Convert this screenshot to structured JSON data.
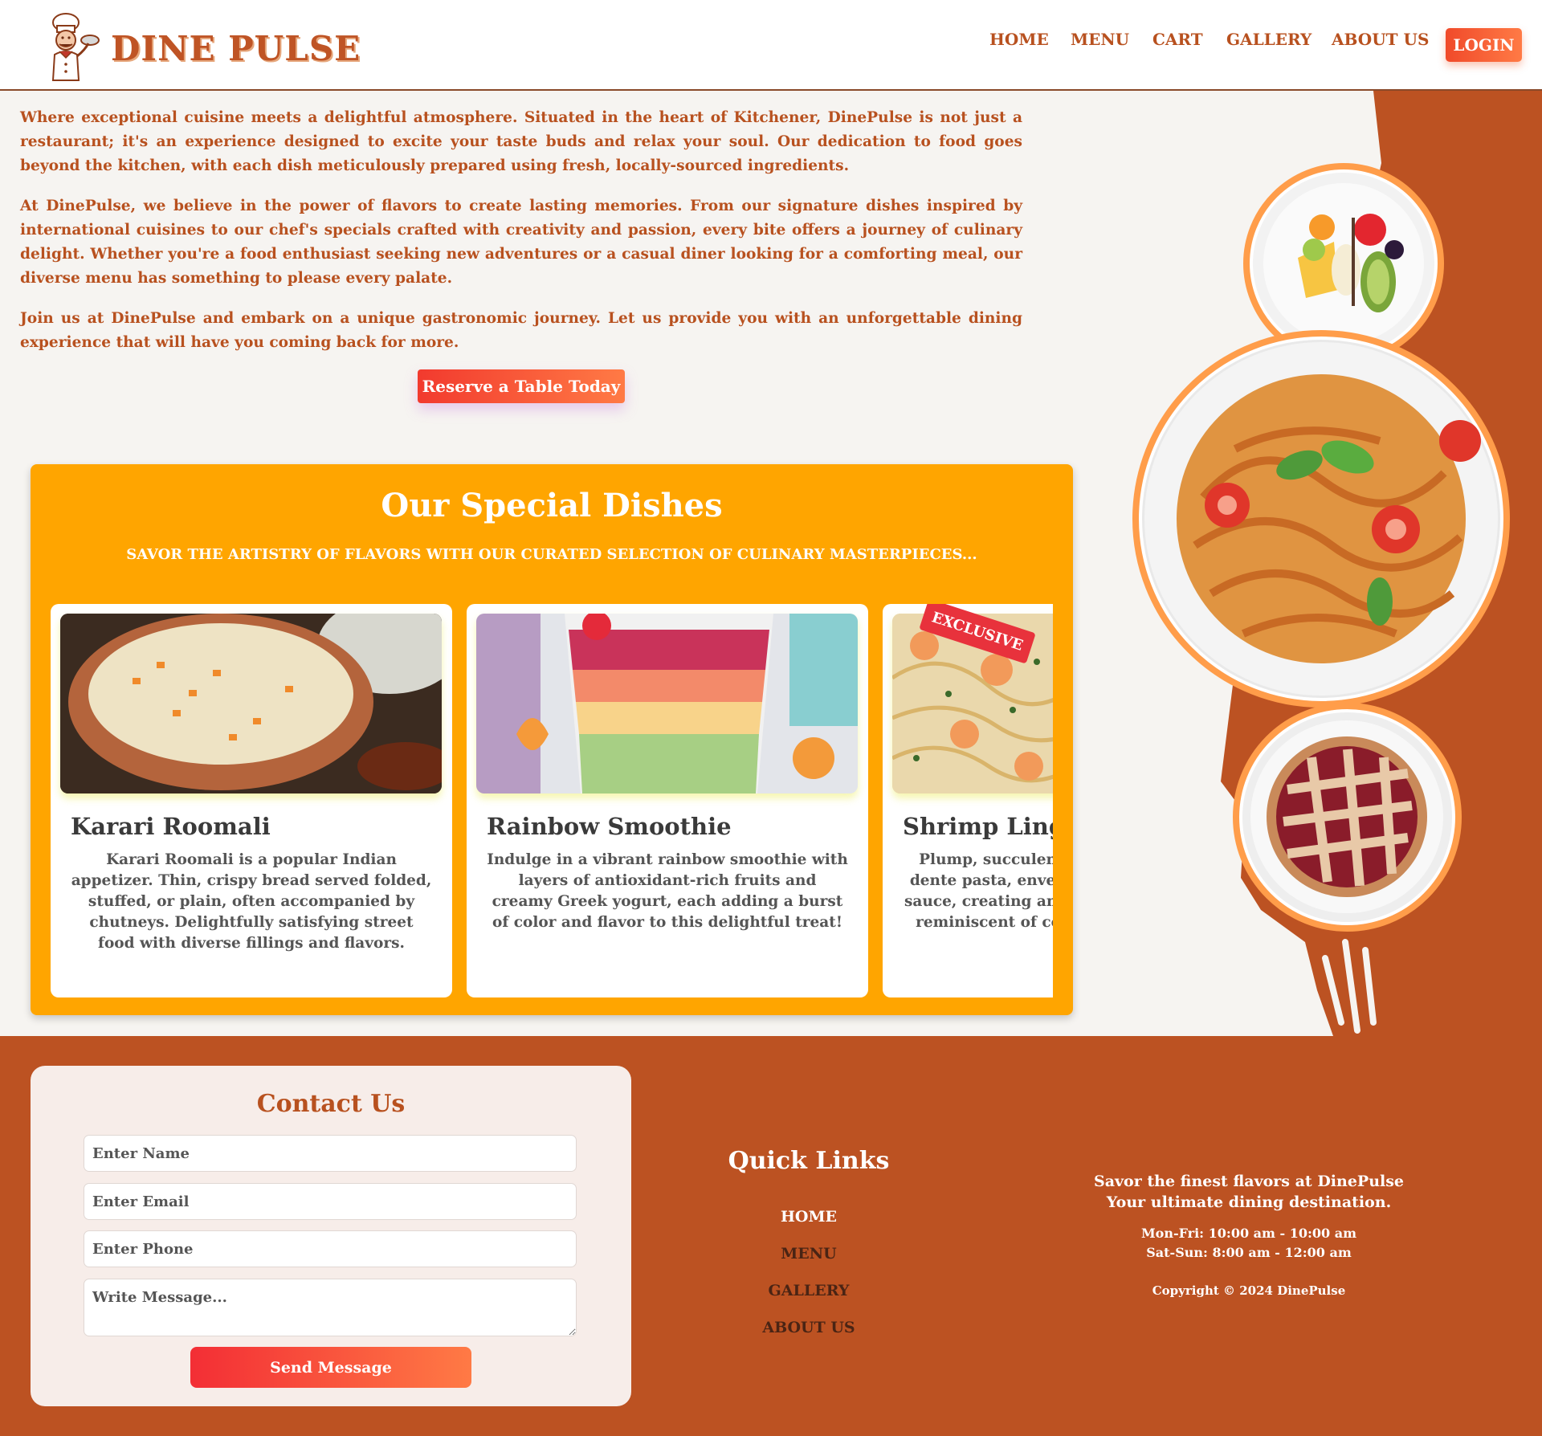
{
  "brand": {
    "name": "DINE PULSE"
  },
  "nav": {
    "items": [
      "HOME",
      "MENU",
      "CART",
      "GALLERY",
      "ABOUT US"
    ],
    "login_label": "LOGIN"
  },
  "intro": {
    "paragraphs": [
      "Where exceptional cuisine meets a delightful atmosphere. Situated in the heart of Kitchener, DinePulse is not just a restaurant; it's an experience designed to excite your taste buds and relax your soul. Our dedication to food goes beyond the kitchen, with each dish meticulously prepared using fresh, locally-sourced ingredients.",
      "At DinePulse, we believe in the power of flavors to create lasting memories. From our signature dishes inspired by international cuisines to our chef's specials crafted with creativity and passion, every bite offers a journey of culinary delight. Whether you're a food enthusiast seeking new adventures or a casual diner looking for a comforting meal, our diverse menu has something to please every palate.",
      "Join us at DinePulse and embark on a unique gastronomic journey. Let us provide you with an unforgettable dining experience that will have you coming back for more."
    ],
    "cta_label": "Reserve a Table Today"
  },
  "specials": {
    "title": "Our Special Dishes",
    "subtitle": "SAVOR THE ARTISTRY OF FLAVORS WITH OUR CURATED SELECTION OF CULINARY MASTERPIECES...",
    "cards": [
      {
        "title": "Karari Roomali",
        "description": "Karari Roomali is a popular Indian appetizer. Thin, crispy bread served folded, stuffed, or plain, often accompanied by chutneys. Delightfully satisfying street food with diverse fillings and flavors.",
        "image": "rice-dish-photo"
      },
      {
        "title": "Rainbow Smoothie",
        "description": "Indulge in a vibrant rainbow smoothie with layers of antioxidant-rich fruits and creamy Greek yogurt, each adding a burst of color and flavor to this delightful treat!",
        "image": "smoothie-photo"
      },
      {
        "title": "Shrimp Linguine",
        "description": "Plump, succulent shrimp tossed with al dente pasta, enveloped in a velvety cream sauce, creating an effortlessly elegant dish reminiscent of coastal Italian trattorias.",
        "image": "shrimp-pasta-photo",
        "badge": "EXCLUSIVE"
      }
    ]
  },
  "contact": {
    "title": "Contact Us",
    "name_placeholder": "Enter Name",
    "email_placeholder": "Enter Email",
    "phone_placeholder": "Enter Phone",
    "message_placeholder": "Write Message...",
    "send_label": "Send Message"
  },
  "quick_links": {
    "title": "Quick Links",
    "items": [
      "HOME",
      "MENU",
      "GALLERY",
      "ABOUT US"
    ]
  },
  "info": {
    "tagline_1": "Savor the finest flavors at DinePulse",
    "tagline_2": "Your ultimate dining destination.",
    "hours_weekday": "Mon-Fri: 10:00 am - 10:00 am",
    "hours_weekend": "Sat-Sun: 8:00 am - 12:00 am",
    "copyright": "Copyright © 2024 DinePulse"
  },
  "colors": {
    "brand": "#b8511f",
    "accent": "#ffa500",
    "footer": "#bc5222",
    "button_start": "#f23a2e",
    "button_end": "#ff7a45"
  }
}
